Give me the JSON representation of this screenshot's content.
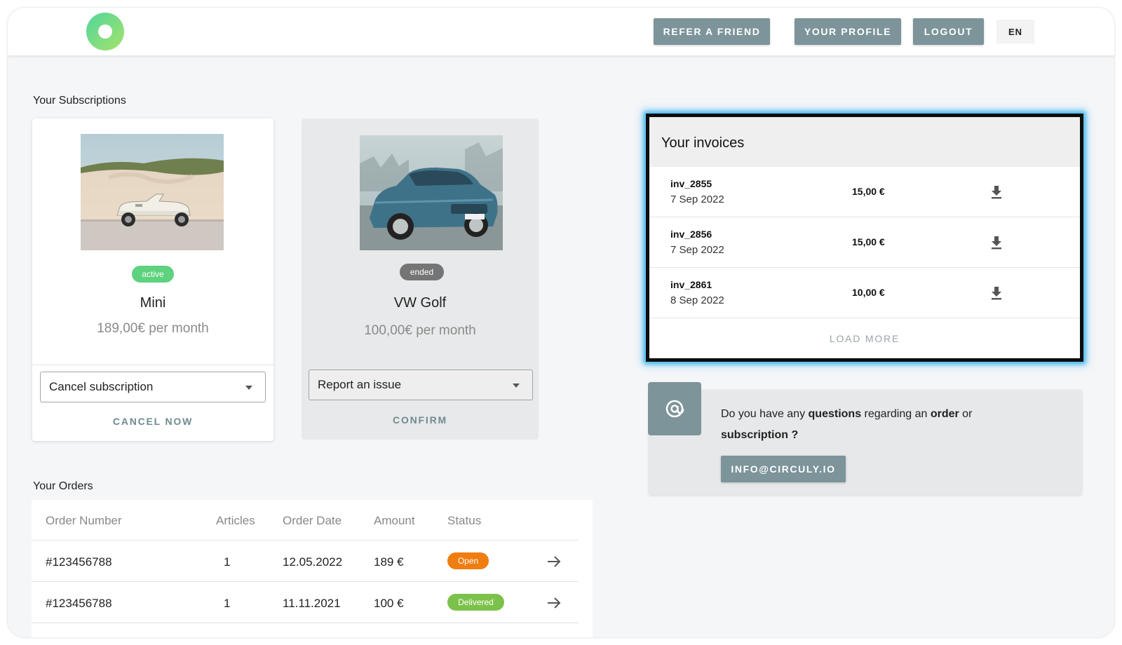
{
  "header": {
    "refer_label": "REFER A FRIEND",
    "profile_label": "YOUR PROFILE",
    "logout_label": "LOGOUT",
    "language": "EN",
    "accent_color": "#7c949a"
  },
  "subscriptions": {
    "title": "Your Subscriptions",
    "items": [
      {
        "status": "active",
        "status_color": "#5ed27e",
        "name": "Mini",
        "price": "189,00€ per month",
        "select_value": "Cancel subscription",
        "action_label": "CANCEL NOW"
      },
      {
        "status": "ended",
        "status_color": "#757575",
        "name": "VW Golf",
        "price": "100,00€ per month",
        "select_value": "Report an issue",
        "action_label": "CONFIRM"
      }
    ]
  },
  "orders": {
    "title": "Your Orders",
    "columns": [
      "Order Number",
      "Articles",
      "Order Date",
      "Amount",
      "Status"
    ],
    "rows": [
      {
        "number": "#123456788",
        "articles": "1",
        "date": "12.05.2022",
        "amount": "189 €",
        "status": "Open",
        "status_color": "#f07d10"
      },
      {
        "number": "#123456788",
        "articles": "1",
        "date": "11.11.2021",
        "amount": "100 €",
        "status": "Delivered",
        "status_color": "#7cc24a"
      }
    ]
  },
  "invoices": {
    "title": "Your invoices",
    "rows": [
      {
        "id": "inv_2855",
        "date": "7 Sep 2022",
        "amount": "15,00 €"
      },
      {
        "id": "inv_2856",
        "date": "7 Sep 2022",
        "amount": "15,00 €"
      },
      {
        "id": "inv_2861",
        "date": "8 Sep 2022",
        "amount": "10,00 €"
      }
    ],
    "load_more_label": "LOAD MORE",
    "highlight_color": "#45b8ef"
  },
  "contact": {
    "q_part1": "Do you have any ",
    "q_bold1": "questions",
    "q_part2": " regarding an ",
    "q_bold2": "order",
    "q_part3": " or ",
    "q_bold3": "subscription ?",
    "email_label": "INFO@CIRCULY.IO",
    "icon": "at-icon"
  }
}
